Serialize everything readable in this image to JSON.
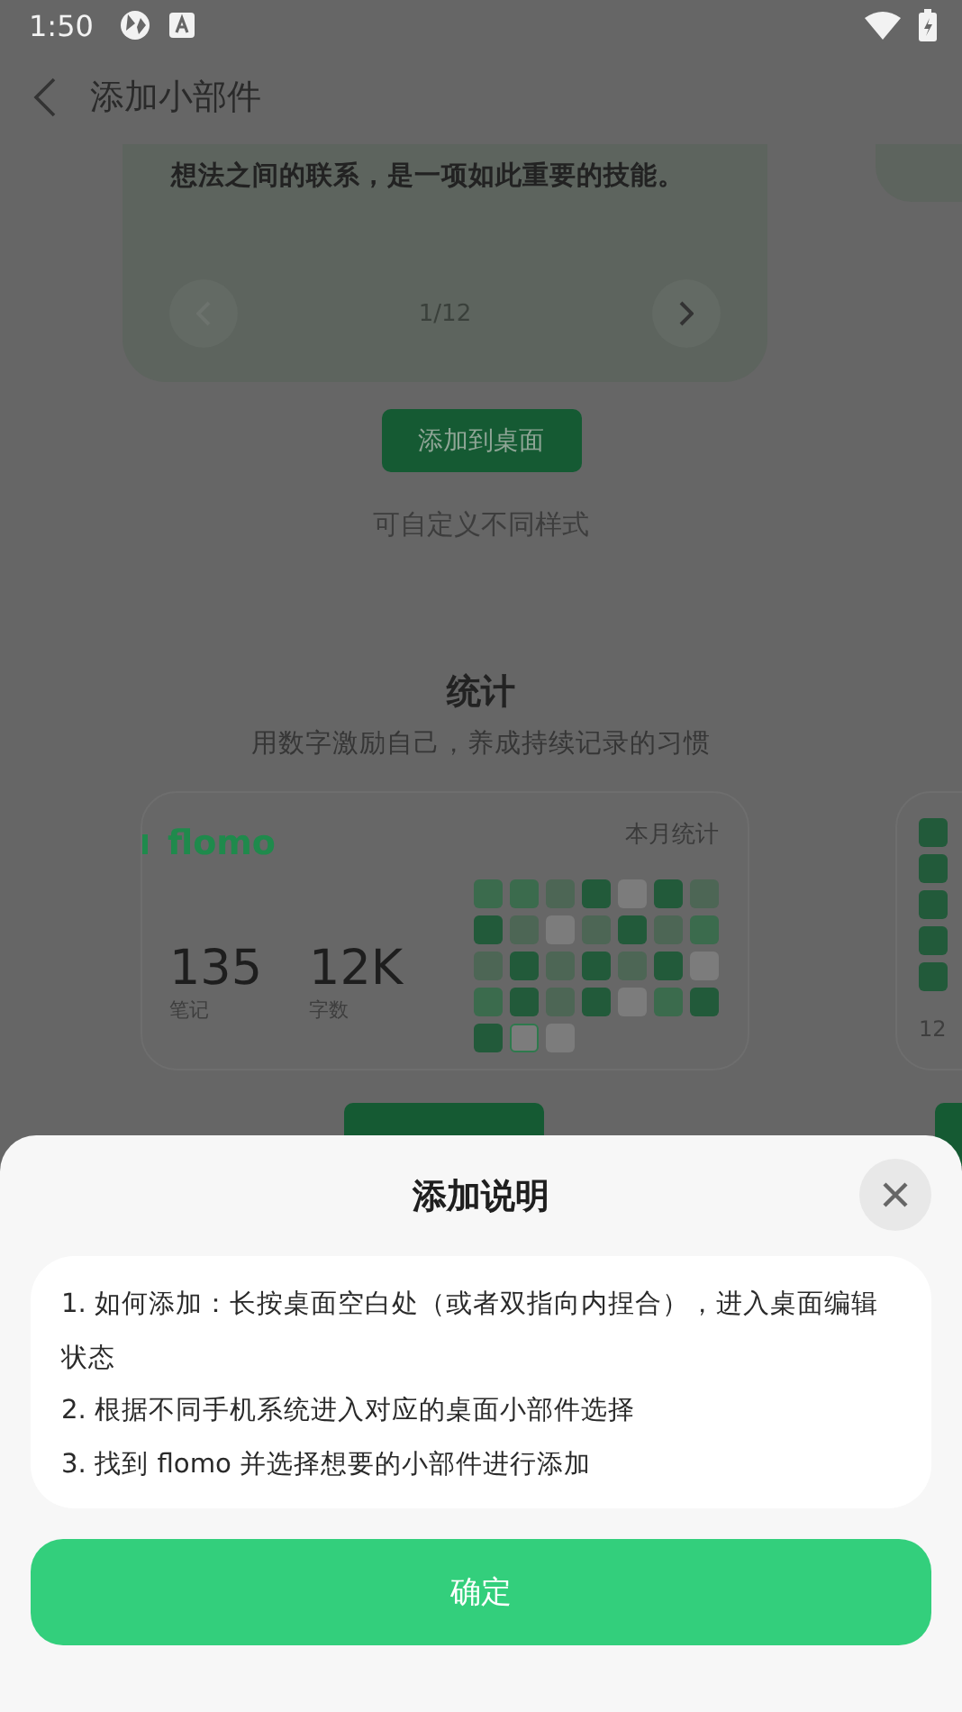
{
  "status_bar": {
    "time": "1:50"
  },
  "app_bar": {
    "title": "添加小部件"
  },
  "quote_section": {
    "card_text": "想法之间的联系，是一项如此重要的技能。",
    "pager": "1/12",
    "prev_disabled": true,
    "next_disabled": false,
    "add_button": "添加到桌面",
    "hint": "可自定义不同样式"
  },
  "stats_section": {
    "title": "统计",
    "subtitle": "用数字激励自己，养成持续记录的习惯",
    "card": {
      "logo": "flomo",
      "heading": "本月统计",
      "stats": [
        {
          "value": "135",
          "label": "笔记"
        },
        {
          "value": "12K",
          "label": "字数"
        }
      ],
      "cells": [
        {
          "color": "#3b6b4d"
        },
        {
          "color": "#3b6b4d"
        },
        {
          "color": "#4d6655"
        },
        {
          "color": "#225a3a"
        },
        {
          "color": "#7c7c7c"
        },
        {
          "color": "#225a3a"
        },
        {
          "color": "#4d6655"
        },
        {
          "color": "#225a3a"
        },
        {
          "color": "#4d6655"
        },
        {
          "color": "#7c7c7c"
        },
        {
          "color": "#4d6655"
        },
        {
          "color": "#225a3a"
        },
        {
          "color": "#4d6655"
        },
        {
          "color": "#3b6b4d"
        },
        {
          "color": "#4d6655"
        },
        {
          "color": "#225a3a"
        },
        {
          "color": "#4d6655"
        },
        {
          "color": "#225a3a"
        },
        {
          "color": "#4d6655"
        },
        {
          "color": "#225a3a"
        },
        {
          "color": "#7c7c7c"
        },
        {
          "color": "#3b6b4d"
        },
        {
          "color": "#225a3a"
        },
        {
          "color": "#4d6655"
        },
        {
          "color": "#225a3a"
        },
        {
          "color": "#7c7c7c"
        },
        {
          "color": "#3b6b4d"
        },
        {
          "color": "#225a3a"
        },
        {
          "color": "#225a3a"
        },
        {
          "color": "#2e7a4d",
          "today": true
        },
        {
          "color": "#7c7c7c"
        }
      ]
    },
    "side_card": {
      "text": "12",
      "cells": [
        {
          "color": "#225a3a"
        },
        {
          "color": "#225a3a"
        },
        {
          "color": "#225a3a"
        },
        {
          "color": "#225a3a"
        },
        {
          "color": "#225a3a"
        }
      ]
    }
  },
  "sheet": {
    "title": "添加说明",
    "steps": [
      "1. 如何添加：长按桌面空白处（或者双指向内捏合），进入桌面编辑状态",
      "2. 根据不同手机系统进入对应的桌面小部件选择",
      "3. 找到 flomo 并选择想要的小部件进行添加"
    ],
    "confirm": "确定"
  }
}
